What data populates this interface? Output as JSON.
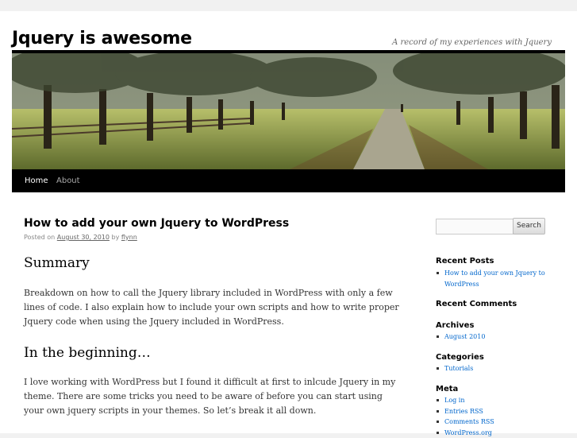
{
  "site": {
    "title": "Jquery is awesome",
    "tagline": "A record of my experiences with Jquery"
  },
  "nav": {
    "items": [
      {
        "label": "Home",
        "current": true
      },
      {
        "label": "About",
        "current": false
      }
    ]
  },
  "post": {
    "title": "How to add your own Jquery to WordPress",
    "meta_prefix": "Posted on",
    "meta_date": "August 30, 2010",
    "meta_by": "by",
    "meta_author": "flynn",
    "sections": [
      {
        "heading": "Summary",
        "body": "Breakdown on how to call the Jquery library included in WordPress with only a few lines of code. I also explain how to include your own scripts and how to write proper Jquery code when using the Jquery included in WordPress."
      },
      {
        "heading": "In the beginning…",
        "body": "I love working with WordPress but I found it difficult at first to inlcude Jquery in my theme. There are some tricks you need to be aware of before you can start using your own jquery scripts in your themes. So let’s break it all down."
      }
    ]
  },
  "sidebar": {
    "search": {
      "value": "",
      "button_label": "Search"
    },
    "widgets": [
      {
        "title": "Recent Posts",
        "items": [
          "How to add your own Jquery to WordPress"
        ]
      },
      {
        "title": "Recent Comments",
        "items": []
      },
      {
        "title": "Archives",
        "items": [
          "August 2010"
        ]
      },
      {
        "title": "Categories",
        "items": [
          "Tutorials"
        ]
      },
      {
        "title": "Meta",
        "items": [
          "Log in",
          "Entries RSS",
          "Comments RSS",
          "WordPress.org"
        ]
      }
    ]
  },
  "colors": {
    "link": "#0066cc",
    "nav_bg": "#000000",
    "page_bg": "#ffffff",
    "body_bg": "#f1f1f1"
  }
}
